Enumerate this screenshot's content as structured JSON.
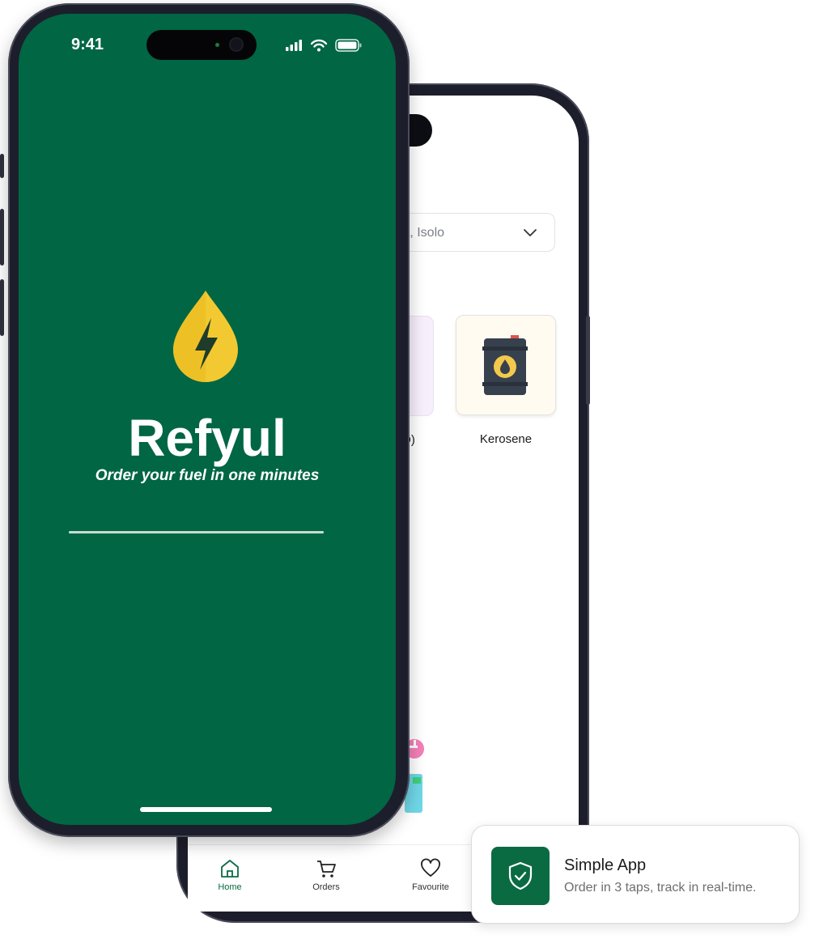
{
  "splash": {
    "status_time": "9:41",
    "brand": "Refyul",
    "tagline": "Order your fuel in one minutes",
    "progress": 1.0
  },
  "home": {
    "location_value": "et, Isolo",
    "fuel_partial_label": "D)",
    "fuel_label": "Kerosene",
    "tabs": [
      {
        "label": "Home",
        "icon": "home-icon"
      },
      {
        "label": "Orders",
        "icon": "cart-icon"
      },
      {
        "label": "Favourite",
        "icon": "heart-icon"
      }
    ]
  },
  "feature": {
    "title": "Simple App",
    "subtitle": "Order in 3 taps, track in real-time.",
    "icon": "shield-check-icon"
  },
  "colors": {
    "brand_green": "#006644",
    "accent_yellow": "#f2c94c",
    "active_tab": "#0a6b43"
  }
}
